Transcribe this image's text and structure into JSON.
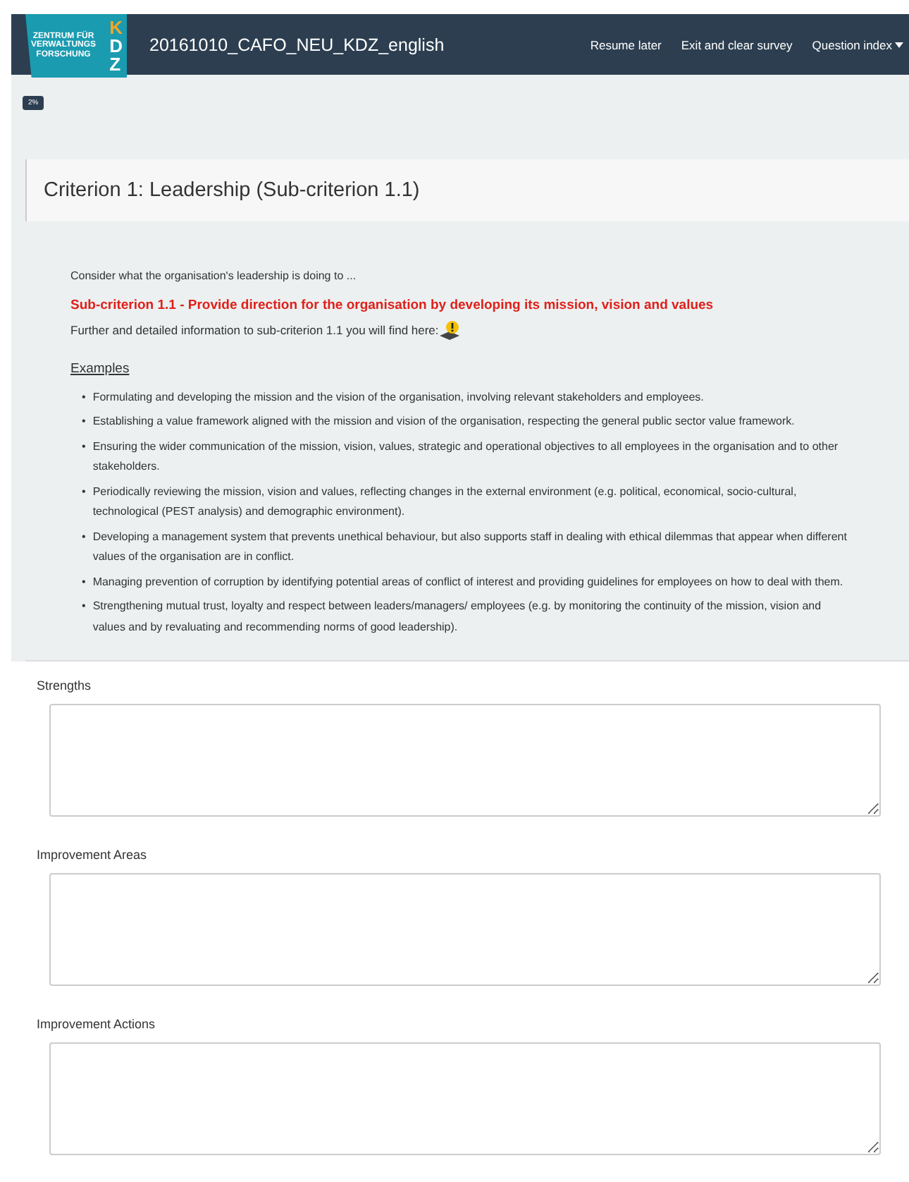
{
  "navbar": {
    "logo": {
      "caption": "ZENTRUM FÜR VERWALTUNGS FORSCHUNG",
      "letters": [
        "K",
        "D",
        "Z"
      ]
    },
    "title": "20161010_CAFO_NEU_KDZ_english",
    "links": [
      {
        "label": "Resume later",
        "dropdown": false
      },
      {
        "label": "Exit and clear survey",
        "dropdown": false
      },
      {
        "label": "Question index",
        "dropdown": true
      }
    ]
  },
  "progress": {
    "label": "2%"
  },
  "group_title": "Criterion 1: Leadership (Sub-criterion 1.1)",
  "description": {
    "intro": "Consider what the organisation's leadership is doing to ...",
    "subtitle": "Sub-criterion 1.1 - Provide direction for the organisation by developing its mission, vision and values",
    "info": "Further and detailed information to sub-criterion 1.1 you will find here:",
    "examples_heading": "Examples",
    "bullet": "•",
    "examples": [
      "Formulating and developing the mission and the vision of the organisation, involving relevant stakeholders and employees.",
      "Establishing a value framework aligned with the mission and vision of the organisation, respecting the general public sector value framework.",
      "Ensuring the wider communication of the mission, vision, values, strategic and operational objectives to all employees in the organisation and to other stakeholders.",
      "Periodically reviewing the mission, vision and values, reflecting changes in the external environment (e.g. political, economical, socio-cultural, technological (PEST analysis) and demographic environment).",
      "Developing a management system that prevents unethical behaviour, but also supports staff in dealing with ethical dilemmas that appear when different values of the organisation are in conflict.",
      "Managing prevention of corruption by identifying potential areas of conflict of interest and providing guidelines for employees on how to deal with them.",
      "Strengthening mutual trust, loyalty and respect between leaders/managers/ employees (e.g. by monitoring the continuity of the mission, vision and values and by revaluating and recommending norms of good leadership)."
    ]
  },
  "questions": [
    {
      "label": "Strengths"
    },
    {
      "label": "Improvement Areas"
    },
    {
      "label": "Improvement Actions"
    }
  ]
}
